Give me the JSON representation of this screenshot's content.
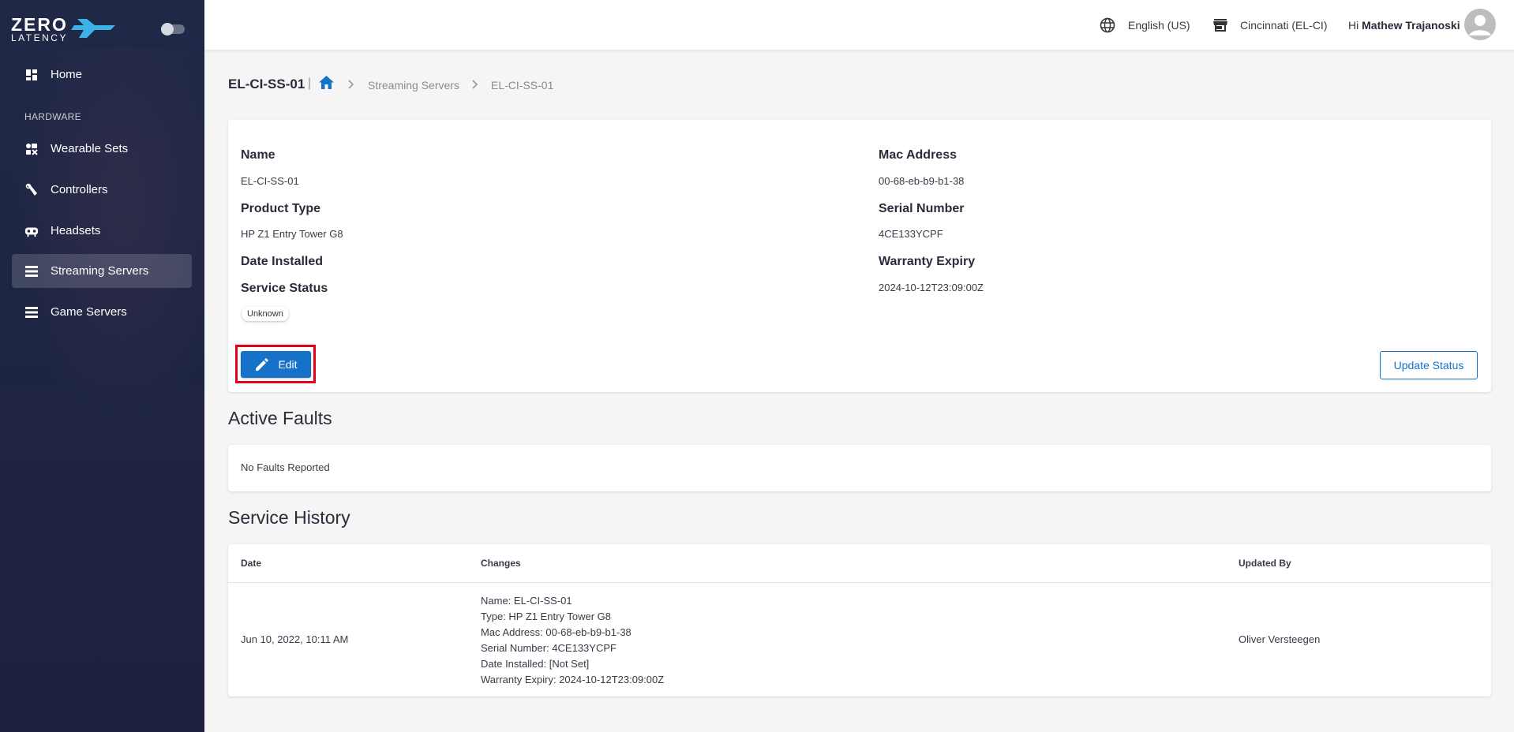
{
  "brand": {
    "line1": "ZERO",
    "line2": "LATENCY"
  },
  "sidebar": {
    "section_label": "HARDWARE",
    "items": [
      {
        "label": "Home",
        "icon": "dashboard-icon"
      },
      {
        "label": "Wearable Sets",
        "icon": "wearable-sets-icon"
      },
      {
        "label": "Controllers",
        "icon": "controller-icon"
      },
      {
        "label": "Headsets",
        "icon": "headset-icon"
      },
      {
        "label": "Streaming Servers",
        "icon": "server-icon",
        "active": true
      },
      {
        "label": "Game Servers",
        "icon": "server-icon"
      }
    ]
  },
  "topbar": {
    "language": "English (US)",
    "location": "Cincinnati (EL-CI)",
    "greeting": "Hi",
    "user_name": "Mathew Trajanoski"
  },
  "breadcrumb": {
    "title": "EL-CI-SS-01",
    "separator": "|",
    "items": [
      "Streaming Servers",
      "EL-CI-SS-01"
    ]
  },
  "details": {
    "name_label": "Name",
    "name_value": "EL-CI-SS-01",
    "product_type_label": "Product Type",
    "product_type_value": "HP Z1 Entry Tower G8",
    "date_installed_label": "Date Installed",
    "service_status_label": "Service Status",
    "service_status_value": "Unknown",
    "mac_label": "Mac Address",
    "mac_value": "00-68-eb-b9-b1-38",
    "serial_label": "Serial Number",
    "serial_value": "4CE133YCPF",
    "warranty_label": "Warranty Expiry",
    "warranty_value": "2024-10-12T23:09:00Z",
    "edit_label": "Edit",
    "update_status_label": "Update Status"
  },
  "active_faults": {
    "title": "Active Faults",
    "empty_text": "No Faults Reported"
  },
  "service_history": {
    "title": "Service History",
    "columns": [
      "Date",
      "Changes",
      "Updated By"
    ],
    "rows": [
      {
        "date": "Jun 10, 2022, 10:11 AM",
        "changes": [
          "Name: EL-CI-SS-01",
          "Type: HP Z1 Entry Tower G8",
          "Mac Address: 00-68-eb-b9-b1-38",
          "Serial Number: 4CE133YCPF",
          "Date Installed: [Not Set]",
          "Warranty Expiry: 2024-10-12T23:09:00Z"
        ],
        "updated_by": "Oliver Versteegen"
      }
    ]
  },
  "colors": {
    "accent": "#1672c8",
    "sidebar": "#1f2946",
    "highlight": "#e3001b"
  }
}
